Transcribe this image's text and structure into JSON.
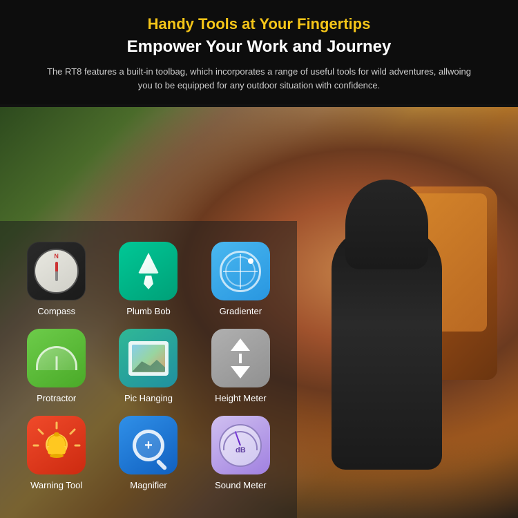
{
  "header": {
    "subtitle": "Handy Tools at Your Fingertips",
    "title": "Empower Your Work and Journey",
    "description": "The RT8 features a built-in toolbag, which incorporates a range of useful tools for wild adventures, allwoing you to be equipped for any outdoor situation with confidence."
  },
  "tools": [
    {
      "id": "compass",
      "label": "Compass",
      "icon_type": "compass"
    },
    {
      "id": "plumb-bob",
      "label": "Plumb Bob",
      "icon_type": "plumbbob"
    },
    {
      "id": "gradienter",
      "label": "Gradienter",
      "icon_type": "gradienter"
    },
    {
      "id": "protractor",
      "label": "Protractor",
      "icon_type": "protractor"
    },
    {
      "id": "pic-hanging",
      "label": "Pic Hanging",
      "icon_type": "pichanging"
    },
    {
      "id": "height-meter",
      "label": "Height Meter",
      "icon_type": "heightmeter"
    },
    {
      "id": "warning-tool",
      "label": "Warning Tool",
      "icon_type": "warningtool"
    },
    {
      "id": "magnifier",
      "label": "Magnifier",
      "icon_type": "magnifier"
    },
    {
      "id": "sound-meter",
      "label": "Sound Meter",
      "icon_type": "soundmeter"
    }
  ],
  "colors": {
    "accent": "#f5c518",
    "header_bg": "#0d0d0d",
    "title_color": "#ffffff",
    "desc_color": "#cccccc"
  }
}
